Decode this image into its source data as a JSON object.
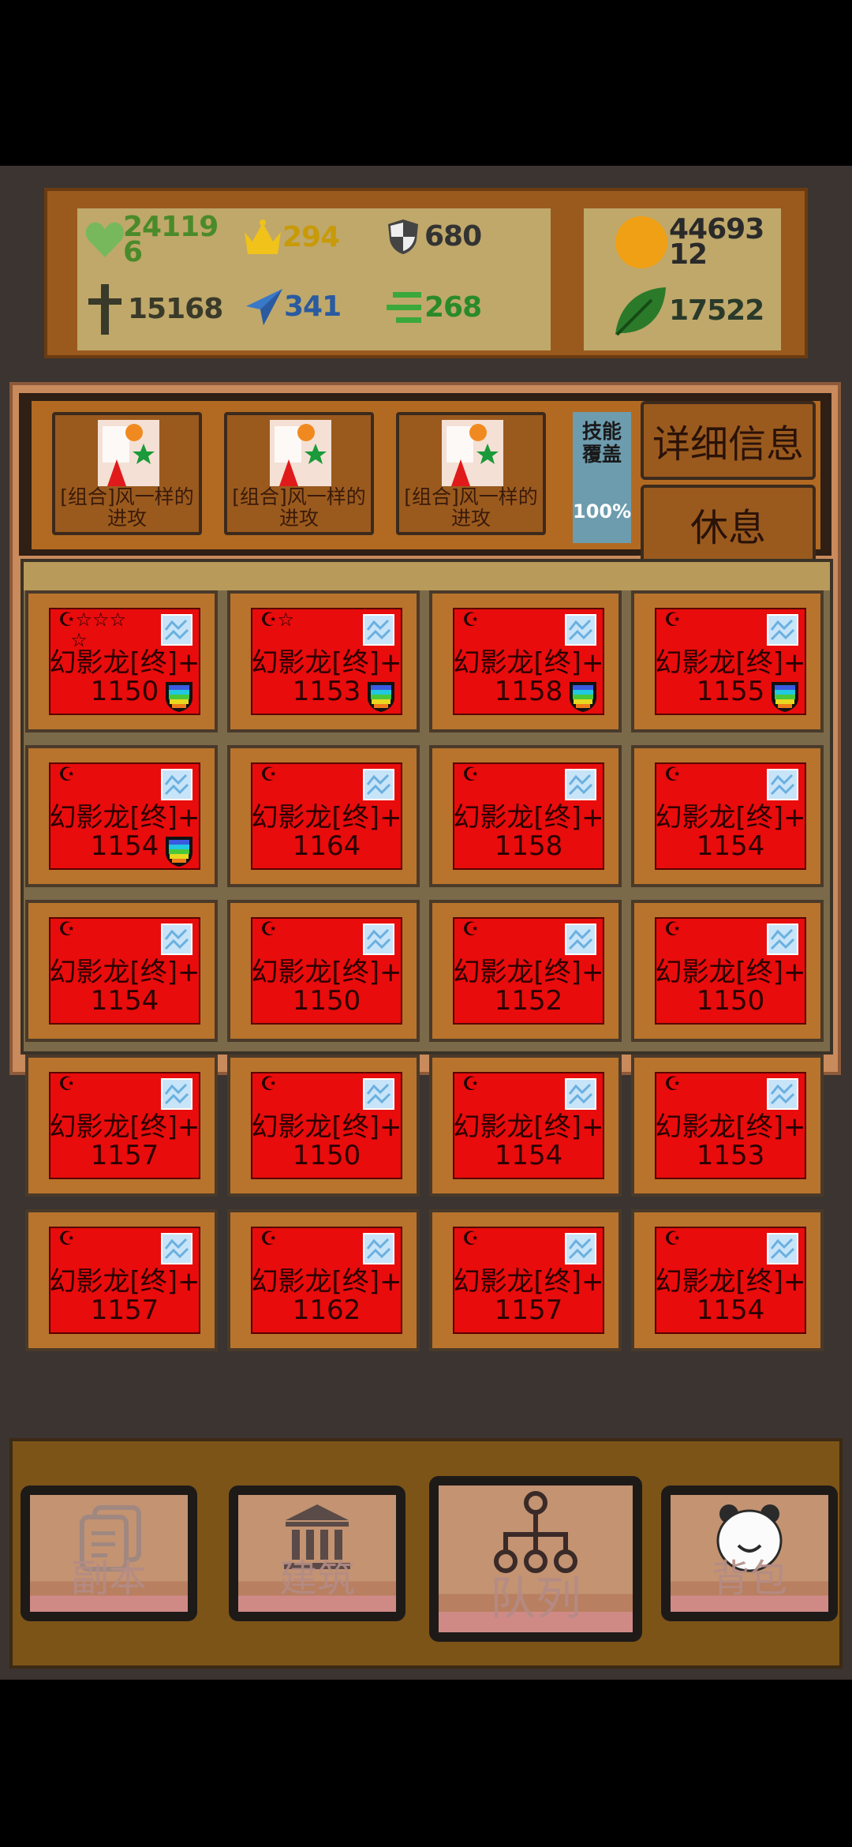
{
  "stats": {
    "hp": {
      "icon": "heart-icon",
      "value": "24119\n6"
    },
    "crown": {
      "icon": "crown-icon",
      "value": "294"
    },
    "defense": {
      "icon": "shield-icon",
      "value": "680"
    },
    "attack": {
      "icon": "sword-icon",
      "value": "15168"
    },
    "speed": {
      "icon": "paper-plane-icon",
      "value": "341"
    },
    "wind": {
      "icon": "wind-icon",
      "value": "268"
    },
    "gold": {
      "icon": "gold-coin-icon",
      "value": "44693\n12"
    },
    "leaf": {
      "icon": "leaf-icon",
      "value": "17522"
    }
  },
  "skills": {
    "slots": [
      {
        "label": "[组合]风一样的进攻"
      },
      {
        "label": "[组合]风一样的进攻"
      },
      {
        "label": "[组合]风一样的进攻"
      }
    ],
    "coverage_label": "技能覆盖",
    "coverage_value": "100%",
    "detail_button": "详细信息",
    "rest_button": "休息"
  },
  "units": [
    {
      "name": "幻影龙[终]+",
      "level": "1150",
      "stars": "☪☆☆☆\n  ☆",
      "shield": true
    },
    {
      "name": "幻影龙[终]+",
      "level": "1153",
      "stars": "☪☆",
      "shield": true
    },
    {
      "name": "幻影龙[终]+",
      "level": "1158",
      "stars": "☪",
      "shield": true
    },
    {
      "name": "幻影龙[终]+",
      "level": "1155",
      "stars": "☪",
      "shield": true
    },
    {
      "name": "幻影龙[终]+",
      "level": "1154",
      "stars": "☪",
      "shield": true
    },
    {
      "name": "幻影龙[终]+",
      "level": "1164",
      "stars": "☪",
      "shield": false
    },
    {
      "name": "幻影龙[终]+",
      "level": "1158",
      "stars": "☪",
      "shield": false
    },
    {
      "name": "幻影龙[终]+",
      "level": "1154",
      "stars": "☪",
      "shield": false
    },
    {
      "name": "幻影龙[终]+",
      "level": "1154",
      "stars": "☪",
      "shield": false
    },
    {
      "name": "幻影龙[终]+",
      "level": "1150",
      "stars": "☪",
      "shield": false
    },
    {
      "name": "幻影龙[终]+",
      "level": "1152",
      "stars": "☪",
      "shield": false
    },
    {
      "name": "幻影龙[终]+",
      "level": "1150",
      "stars": "☪",
      "shield": false
    },
    {
      "name": "幻影龙[终]+",
      "level": "1157",
      "stars": "☪",
      "shield": false
    },
    {
      "name": "幻影龙[终]+",
      "level": "1150",
      "stars": "☪",
      "shield": false
    },
    {
      "name": "幻影龙[终]+",
      "level": "1154",
      "stars": "☪",
      "shield": false
    },
    {
      "name": "幻影龙[终]+",
      "level": "1153",
      "stars": "☪",
      "shield": false
    },
    {
      "name": "幻影龙[终]+",
      "level": "1157",
      "stars": "☪",
      "shield": false
    },
    {
      "name": "幻影龙[终]+",
      "level": "1162",
      "stars": "☪",
      "shield": false
    },
    {
      "name": "幻影龙[终]+",
      "level": "1157",
      "stars": "☪",
      "shield": false
    },
    {
      "name": "幻影龙[终]+",
      "level": "1154",
      "stars": "☪",
      "shield": false
    }
  ],
  "nav": [
    {
      "label": "副本",
      "icon": "document-icon"
    },
    {
      "label": "建筑",
      "icon": "building-icon"
    },
    {
      "label": "队列",
      "icon": "hierarchy-icon"
    },
    {
      "label": "背包",
      "icon": "bag-icon"
    }
  ],
  "colors": {
    "card_red": "#e80c0c",
    "panel_gold": "#bfa86a",
    "wood": "#b8742c"
  }
}
